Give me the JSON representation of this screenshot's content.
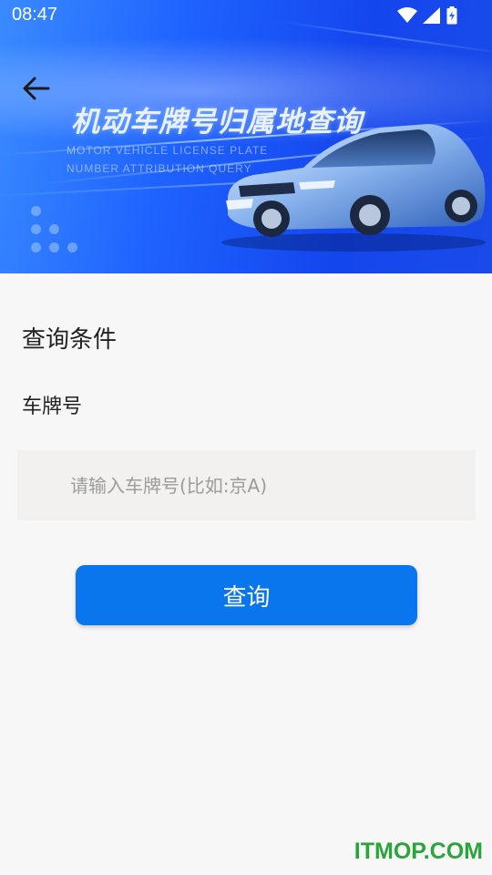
{
  "status_bar": {
    "time": "08:47",
    "icons": [
      "wifi-icon",
      "cellular-signal-icon",
      "battery-charging-icon"
    ]
  },
  "banner": {
    "title": "机动车牌号归属地查询",
    "subtitle_line1": "MOTOR VEHICLE LICENSE PLATE",
    "subtitle_line2": "NUMBER ATTRIBUTION QUERY"
  },
  "form": {
    "section_title": "查询条件",
    "plate_label": "车牌号",
    "plate_placeholder": "请输入车牌号(比如:京A)",
    "plate_value": "",
    "submit_label": "查询"
  },
  "watermark": "ITMOP.COM",
  "colors": {
    "banner_blue": "#1f63ff",
    "button_blue": "#0a76ee",
    "input_bg": "#f2f1ef",
    "watermark_green": "#2aa53a"
  }
}
